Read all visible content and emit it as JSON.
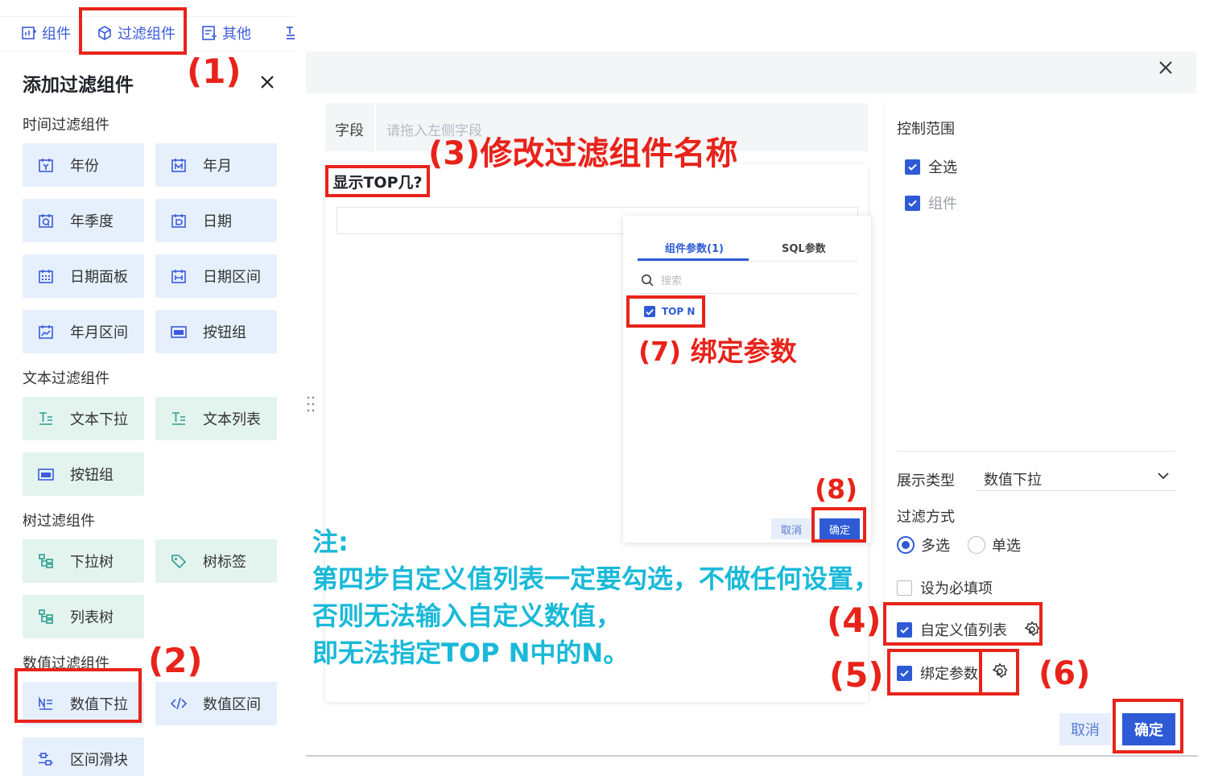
{
  "toolbar": {
    "tabs": [
      {
        "label": "组件",
        "icon": "component-icon"
      },
      {
        "label": "过滤组件",
        "icon": "filter-cube-icon"
      },
      {
        "label": "其他",
        "icon": "other-icon"
      }
    ]
  },
  "panel": {
    "title": "添加过滤组件",
    "sections": {
      "time": "时间过滤组件",
      "text": "文本过滤组件",
      "tree": "树过滤组件",
      "number": "数值过滤组件"
    },
    "time_items": [
      "年份",
      "年月",
      "年季度",
      "日期",
      "日期面板",
      "日期区间",
      "年月区间",
      "按钮组"
    ],
    "text_items": [
      "文本下拉",
      "文本列表",
      "按钮组"
    ],
    "tree_items": [
      "下拉树",
      "树标签",
      "列表树"
    ],
    "number_items": [
      "数值下拉",
      "数值区间",
      "区间滑块"
    ]
  },
  "dialog": {
    "field_label": "字段",
    "field_placeholder": "请拖入左侧字段",
    "component_name": "显示TOP几?",
    "popup": {
      "tab_component_params": "组件参数(1)",
      "tab_sql_params": "SQL参数",
      "search_placeholder": "搜索",
      "param_item": "TOP N",
      "cancel": "取消",
      "confirm": "确定"
    },
    "right": {
      "control_scope": "控制范围",
      "select_all": "全选",
      "component": "组件",
      "display_type_label": "展示类型",
      "display_type_value": "数值下拉",
      "filter_mode_label": "过滤方式",
      "multi": "多选",
      "single": "单选",
      "required": "设为必填项",
      "custom_value_list": "自定义值列表",
      "bind_params": "绑定参数"
    },
    "cancel": "取消",
    "confirm": "确定"
  },
  "annotations": {
    "step1": "(1)",
    "step2": "(2)",
    "step3": "(3)修改过滤组件名称",
    "step4": "(4)",
    "step5": "(5)",
    "step6": "(6)",
    "step7": "(7) 绑定参数",
    "step8": "(8)",
    "note_title": "注:",
    "note_line1": "第四步自定义值列表一定要勾选，不做任何设置，",
    "note_line2": "否则无法输入自定义数值，",
    "note_line3": "即无法指定TOP N中的N。"
  },
  "colors": {
    "accent": "#2e5bd5",
    "annotation_red": "#e8231a",
    "note_cyan": "#19b9d8",
    "item_bg": "#e6f0fd"
  }
}
